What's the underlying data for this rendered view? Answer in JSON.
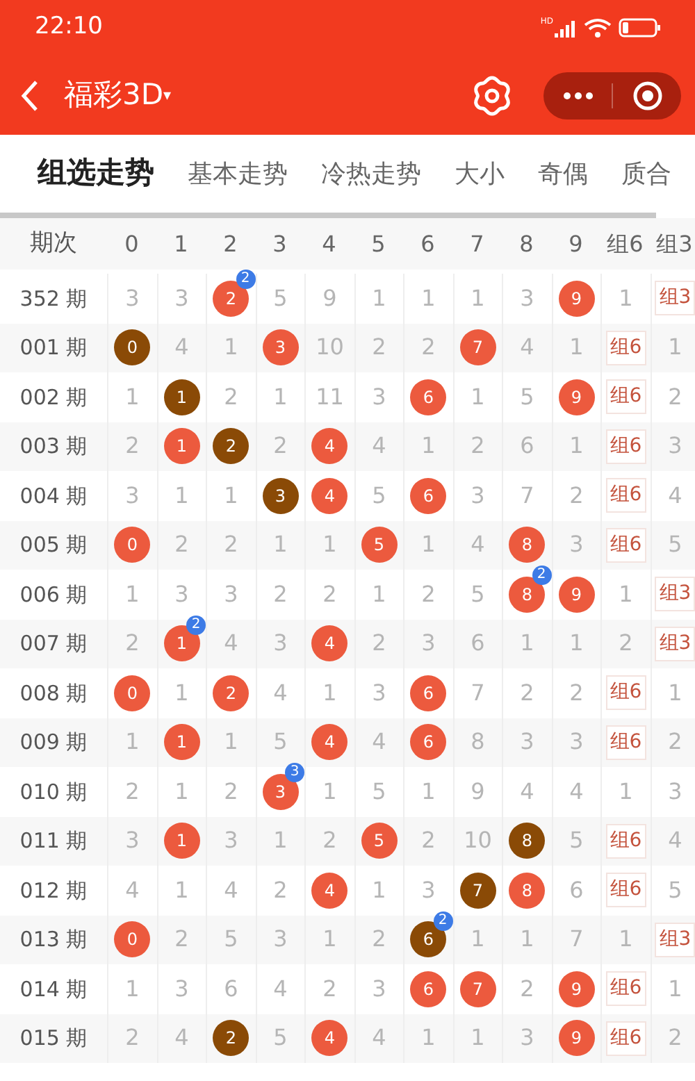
{
  "status_bar": {
    "time": "22:10",
    "signal_label": "HD"
  },
  "nav": {
    "title": "福彩3D",
    "title_caret": "▾"
  },
  "tabs": [
    {
      "label": "组选走势",
      "selected": true
    },
    {
      "label": "基本走势",
      "selected": false
    },
    {
      "label": "冷热走势",
      "selected": false
    },
    {
      "label": "大小",
      "selected": false
    },
    {
      "label": "奇偶",
      "selected": false
    },
    {
      "label": "质合",
      "selected": false
    }
  ],
  "table": {
    "columns": [
      "期次",
      "0",
      "1",
      "2",
      "3",
      "4",
      "5",
      "6",
      "7",
      "8",
      "9",
      "组6",
      "组3"
    ],
    "rows": [
      {
        "cells": [
          {
            "kind": "issue",
            "text": "352 期"
          },
          {
            "kind": "num",
            "text": "3"
          },
          {
            "kind": "num",
            "text": "3"
          },
          {
            "kind": "ball",
            "text": "2",
            "color": "#ec5a3e",
            "badge": "2"
          },
          {
            "kind": "num",
            "text": "5"
          },
          {
            "kind": "num",
            "text": "9"
          },
          {
            "kind": "num",
            "text": "1"
          },
          {
            "kind": "num",
            "text": "1"
          },
          {
            "kind": "num",
            "text": "1"
          },
          {
            "kind": "num",
            "text": "3"
          },
          {
            "kind": "ball",
            "text": "9",
            "color": "#ec5a3e"
          },
          {
            "kind": "num",
            "text": "1"
          },
          {
            "kind": "tag",
            "text": "组3"
          }
        ]
      },
      {
        "cells": [
          {
            "kind": "issue",
            "text": "001 期"
          },
          {
            "kind": "ball",
            "text": "0",
            "color": "#8a4a06"
          },
          {
            "kind": "num",
            "text": "4"
          },
          {
            "kind": "num",
            "text": "1"
          },
          {
            "kind": "ball",
            "text": "3",
            "color": "#ec5a3e"
          },
          {
            "kind": "num",
            "text": "10"
          },
          {
            "kind": "num",
            "text": "2"
          },
          {
            "kind": "num",
            "text": "2"
          },
          {
            "kind": "ball",
            "text": "7",
            "color": "#ec5a3e"
          },
          {
            "kind": "num",
            "text": "4"
          },
          {
            "kind": "num",
            "text": "1"
          },
          {
            "kind": "tag",
            "text": "组6"
          },
          {
            "kind": "num",
            "text": "1"
          }
        ]
      },
      {
        "cells": [
          {
            "kind": "issue",
            "text": "002 期"
          },
          {
            "kind": "num",
            "text": "1"
          },
          {
            "kind": "ball",
            "text": "1",
            "color": "#8a4a06"
          },
          {
            "kind": "num",
            "text": "2"
          },
          {
            "kind": "num",
            "text": "1"
          },
          {
            "kind": "num",
            "text": "11"
          },
          {
            "kind": "num",
            "text": "3"
          },
          {
            "kind": "ball",
            "text": "6",
            "color": "#ec5a3e"
          },
          {
            "kind": "num",
            "text": "1"
          },
          {
            "kind": "num",
            "text": "5"
          },
          {
            "kind": "ball",
            "text": "9",
            "color": "#ec5a3e"
          },
          {
            "kind": "tag",
            "text": "组6"
          },
          {
            "kind": "num",
            "text": "2"
          }
        ]
      },
      {
        "cells": [
          {
            "kind": "issue",
            "text": "003 期"
          },
          {
            "kind": "num",
            "text": "2"
          },
          {
            "kind": "ball",
            "text": "1",
            "color": "#ec5a3e"
          },
          {
            "kind": "ball",
            "text": "2",
            "color": "#8a4a06"
          },
          {
            "kind": "num",
            "text": "2"
          },
          {
            "kind": "ball",
            "text": "4",
            "color": "#ec5a3e"
          },
          {
            "kind": "num",
            "text": "4"
          },
          {
            "kind": "num",
            "text": "1"
          },
          {
            "kind": "num",
            "text": "2"
          },
          {
            "kind": "num",
            "text": "6"
          },
          {
            "kind": "num",
            "text": "1"
          },
          {
            "kind": "tag",
            "text": "组6"
          },
          {
            "kind": "num",
            "text": "3"
          }
        ]
      },
      {
        "cells": [
          {
            "kind": "issue",
            "text": "004 期"
          },
          {
            "kind": "num",
            "text": "3"
          },
          {
            "kind": "num",
            "text": "1"
          },
          {
            "kind": "num",
            "text": "1"
          },
          {
            "kind": "ball",
            "text": "3",
            "color": "#8a4a06"
          },
          {
            "kind": "ball",
            "text": "4",
            "color": "#ec5a3e"
          },
          {
            "kind": "num",
            "text": "5"
          },
          {
            "kind": "ball",
            "text": "6",
            "color": "#ec5a3e"
          },
          {
            "kind": "num",
            "text": "3"
          },
          {
            "kind": "num",
            "text": "7"
          },
          {
            "kind": "num",
            "text": "2"
          },
          {
            "kind": "tag",
            "text": "组6"
          },
          {
            "kind": "num",
            "text": "4"
          }
        ]
      },
      {
        "cells": [
          {
            "kind": "issue",
            "text": "005 期"
          },
          {
            "kind": "ball",
            "text": "0",
            "color": "#ec5a3e"
          },
          {
            "kind": "num",
            "text": "2"
          },
          {
            "kind": "num",
            "text": "2"
          },
          {
            "kind": "num",
            "text": "1"
          },
          {
            "kind": "num",
            "text": "1"
          },
          {
            "kind": "ball",
            "text": "5",
            "color": "#ec5a3e"
          },
          {
            "kind": "num",
            "text": "1"
          },
          {
            "kind": "num",
            "text": "4"
          },
          {
            "kind": "ball",
            "text": "8",
            "color": "#ec5a3e"
          },
          {
            "kind": "num",
            "text": "3"
          },
          {
            "kind": "tag",
            "text": "组6"
          },
          {
            "kind": "num",
            "text": "5"
          }
        ]
      },
      {
        "cells": [
          {
            "kind": "issue",
            "text": "006 期"
          },
          {
            "kind": "num",
            "text": "1"
          },
          {
            "kind": "num",
            "text": "3"
          },
          {
            "kind": "num",
            "text": "3"
          },
          {
            "kind": "num",
            "text": "2"
          },
          {
            "kind": "num",
            "text": "2"
          },
          {
            "kind": "num",
            "text": "1"
          },
          {
            "kind": "num",
            "text": "2"
          },
          {
            "kind": "num",
            "text": "5"
          },
          {
            "kind": "ball",
            "text": "8",
            "color": "#ec5a3e",
            "badge": "2"
          },
          {
            "kind": "ball",
            "text": "9",
            "color": "#ec5a3e"
          },
          {
            "kind": "num",
            "text": "1"
          },
          {
            "kind": "tag",
            "text": "组3"
          }
        ]
      },
      {
        "cells": [
          {
            "kind": "issue",
            "text": "007 期"
          },
          {
            "kind": "num",
            "text": "2"
          },
          {
            "kind": "ball",
            "text": "1",
            "color": "#ec5a3e",
            "badge": "2"
          },
          {
            "kind": "num",
            "text": "4"
          },
          {
            "kind": "num",
            "text": "3"
          },
          {
            "kind": "ball",
            "text": "4",
            "color": "#ec5a3e"
          },
          {
            "kind": "num",
            "text": "2"
          },
          {
            "kind": "num",
            "text": "3"
          },
          {
            "kind": "num",
            "text": "6"
          },
          {
            "kind": "num",
            "text": "1"
          },
          {
            "kind": "num",
            "text": "1"
          },
          {
            "kind": "num",
            "text": "2"
          },
          {
            "kind": "tag",
            "text": "组3"
          }
        ]
      },
      {
        "cells": [
          {
            "kind": "issue",
            "text": "008 期"
          },
          {
            "kind": "ball",
            "text": "0",
            "color": "#ec5a3e"
          },
          {
            "kind": "num",
            "text": "1"
          },
          {
            "kind": "ball",
            "text": "2",
            "color": "#ec5a3e"
          },
          {
            "kind": "num",
            "text": "4"
          },
          {
            "kind": "num",
            "text": "1"
          },
          {
            "kind": "num",
            "text": "3"
          },
          {
            "kind": "ball",
            "text": "6",
            "color": "#ec5a3e"
          },
          {
            "kind": "num",
            "text": "7"
          },
          {
            "kind": "num",
            "text": "2"
          },
          {
            "kind": "num",
            "text": "2"
          },
          {
            "kind": "tag",
            "text": "组6"
          },
          {
            "kind": "num",
            "text": "1"
          }
        ]
      },
      {
        "cells": [
          {
            "kind": "issue",
            "text": "009 期"
          },
          {
            "kind": "num",
            "text": "1"
          },
          {
            "kind": "ball",
            "text": "1",
            "color": "#ec5a3e"
          },
          {
            "kind": "num",
            "text": "1"
          },
          {
            "kind": "num",
            "text": "5"
          },
          {
            "kind": "ball",
            "text": "4",
            "color": "#ec5a3e"
          },
          {
            "kind": "num",
            "text": "4"
          },
          {
            "kind": "ball",
            "text": "6",
            "color": "#ec5a3e"
          },
          {
            "kind": "num",
            "text": "8"
          },
          {
            "kind": "num",
            "text": "3"
          },
          {
            "kind": "num",
            "text": "3"
          },
          {
            "kind": "tag",
            "text": "组6"
          },
          {
            "kind": "num",
            "text": "2"
          }
        ]
      },
      {
        "cells": [
          {
            "kind": "issue",
            "text": "010 期"
          },
          {
            "kind": "num",
            "text": "2"
          },
          {
            "kind": "num",
            "text": "1"
          },
          {
            "kind": "num",
            "text": "2"
          },
          {
            "kind": "ball",
            "text": "3",
            "color": "#ec5a3e",
            "badge": "3"
          },
          {
            "kind": "num",
            "text": "1"
          },
          {
            "kind": "num",
            "text": "5"
          },
          {
            "kind": "num",
            "text": "1"
          },
          {
            "kind": "num",
            "text": "9"
          },
          {
            "kind": "num",
            "text": "4"
          },
          {
            "kind": "num",
            "text": "4"
          },
          {
            "kind": "num",
            "text": "1"
          },
          {
            "kind": "num",
            "text": "3"
          }
        ]
      },
      {
        "cells": [
          {
            "kind": "issue",
            "text": "011 期"
          },
          {
            "kind": "num",
            "text": "3"
          },
          {
            "kind": "ball",
            "text": "1",
            "color": "#ec5a3e"
          },
          {
            "kind": "num",
            "text": "3"
          },
          {
            "kind": "num",
            "text": "1"
          },
          {
            "kind": "num",
            "text": "2"
          },
          {
            "kind": "ball",
            "text": "5",
            "color": "#ec5a3e"
          },
          {
            "kind": "num",
            "text": "2"
          },
          {
            "kind": "num",
            "text": "10"
          },
          {
            "kind": "ball",
            "text": "8",
            "color": "#8a4a06"
          },
          {
            "kind": "num",
            "text": "5"
          },
          {
            "kind": "tag",
            "text": "组6"
          },
          {
            "kind": "num",
            "text": "4"
          }
        ]
      },
      {
        "cells": [
          {
            "kind": "issue",
            "text": "012 期"
          },
          {
            "kind": "num",
            "text": "4"
          },
          {
            "kind": "num",
            "text": "1"
          },
          {
            "kind": "num",
            "text": "4"
          },
          {
            "kind": "num",
            "text": "2"
          },
          {
            "kind": "ball",
            "text": "4",
            "color": "#ec5a3e"
          },
          {
            "kind": "num",
            "text": "1"
          },
          {
            "kind": "num",
            "text": "3"
          },
          {
            "kind": "ball",
            "text": "7",
            "color": "#8a4a06"
          },
          {
            "kind": "ball",
            "text": "8",
            "color": "#ec5a3e"
          },
          {
            "kind": "num",
            "text": "6"
          },
          {
            "kind": "tag",
            "text": "组6"
          },
          {
            "kind": "num",
            "text": "5"
          }
        ]
      },
      {
        "cells": [
          {
            "kind": "issue",
            "text": "013 期"
          },
          {
            "kind": "ball",
            "text": "0",
            "color": "#ec5a3e"
          },
          {
            "kind": "num",
            "text": "2"
          },
          {
            "kind": "num",
            "text": "5"
          },
          {
            "kind": "num",
            "text": "3"
          },
          {
            "kind": "num",
            "text": "1"
          },
          {
            "kind": "num",
            "text": "2"
          },
          {
            "kind": "ball",
            "text": "6",
            "color": "#8a4a06",
            "badge": "2"
          },
          {
            "kind": "num",
            "text": "1"
          },
          {
            "kind": "num",
            "text": "1"
          },
          {
            "kind": "num",
            "text": "7"
          },
          {
            "kind": "num",
            "text": "1"
          },
          {
            "kind": "tag",
            "text": "组3"
          }
        ]
      },
      {
        "cells": [
          {
            "kind": "issue",
            "text": "014 期"
          },
          {
            "kind": "num",
            "text": "1"
          },
          {
            "kind": "num",
            "text": "3"
          },
          {
            "kind": "num",
            "text": "6"
          },
          {
            "kind": "num",
            "text": "4"
          },
          {
            "kind": "num",
            "text": "2"
          },
          {
            "kind": "num",
            "text": "3"
          },
          {
            "kind": "ball",
            "text": "6",
            "color": "#ec5a3e"
          },
          {
            "kind": "ball",
            "text": "7",
            "color": "#ec5a3e"
          },
          {
            "kind": "num",
            "text": "2"
          },
          {
            "kind": "ball",
            "text": "9",
            "color": "#ec5a3e"
          },
          {
            "kind": "tag",
            "text": "组6"
          },
          {
            "kind": "num",
            "text": "1"
          }
        ]
      },
      {
        "cells": [
          {
            "kind": "issue",
            "text": "015 期"
          },
          {
            "kind": "num",
            "text": "2"
          },
          {
            "kind": "num",
            "text": "4"
          },
          {
            "kind": "ball",
            "text": "2",
            "color": "#8a4a06"
          },
          {
            "kind": "num",
            "text": "5"
          },
          {
            "kind": "ball",
            "text": "4",
            "color": "#ec5a3e"
          },
          {
            "kind": "num",
            "text": "4"
          },
          {
            "kind": "num",
            "text": "1"
          },
          {
            "kind": "num",
            "text": "1"
          },
          {
            "kind": "num",
            "text": "3"
          },
          {
            "kind": "ball",
            "text": "9",
            "color": "#ec5a3e"
          },
          {
            "kind": "tag",
            "text": "组6"
          },
          {
            "kind": "num",
            "text": "2"
          }
        ]
      }
    ]
  }
}
